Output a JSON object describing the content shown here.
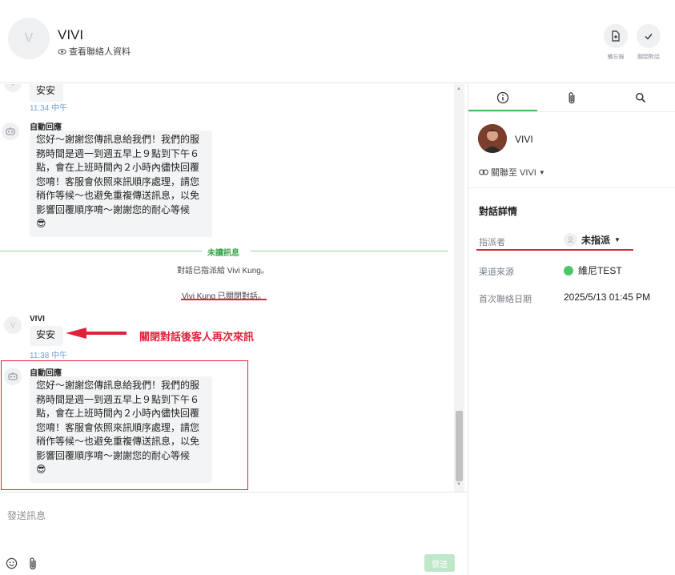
{
  "header": {
    "avatar_letter": "V",
    "name": "VIVI",
    "view_profile": "查看聯絡人資料",
    "memo_label": "備忘錄",
    "close_label": "關閉對話"
  },
  "messages": {
    "first_bubble": "安安",
    "first_time": "11:34 中午",
    "bot_name": "自動回應",
    "bot_lines": [
      "您好～謝謝您傳訊息給我們！我們的服",
      "務時間是週一到週五早上９點到下午６",
      "點，會在上班時間內２小時內儘快回覆",
      "您唷！客服會依照來訊順序處理，請您",
      "稍作等候～也避免重複傳送訊息，以免",
      "影響回覆順序唷～謝謝您的耐心等候"
    ],
    "emoji": "😎",
    "unread_label": "未讀訊息",
    "assigned_msg": "對話已指派給 Vivi Kung。",
    "closed_msg": "Vivi Kung 已關閉對話。",
    "vivi_avatar": "V",
    "vivi_name": "VIVI",
    "vivi_bubble": "安安",
    "vivi_time": "11:38 中午",
    "bot_name_2": "自動回應"
  },
  "annotation": {
    "text": "關閉對話後客人再次來訊",
    "color": "#e0213a"
  },
  "composer": {
    "placeholder": "發送訊息",
    "send_label": "發送"
  },
  "right_panel": {
    "contact_name": "VIVI",
    "link_label": "關聯至 VIVI",
    "section_title": "對話詳情",
    "assignee_label": "指派者",
    "assignee_value": "未指派",
    "channel_label": "渠道來源",
    "channel_value": "維尼TEST",
    "first_contact_label": "首次聯絡日期",
    "first_contact_value": "2025/5/13 01:45 PM"
  },
  "colors": {
    "accent": "#46b85c",
    "annotation_red": "#e0213a",
    "time_blue": "#6f9fd4"
  }
}
